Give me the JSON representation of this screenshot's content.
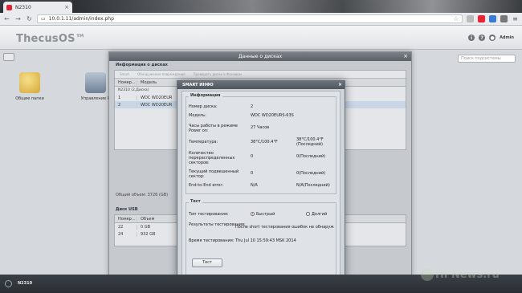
{
  "browser": {
    "tab_title": "N2310",
    "url": "10.0.1.11/admin/index.php"
  },
  "app": {
    "logo": "ThecusOS™",
    "admin_label": "Admin"
  },
  "desktop": {
    "search_placeholder": "Поиск подсистемы",
    "icons": [
      {
        "label": "Общие папки"
      },
      {
        "label": "Управление R"
      }
    ]
  },
  "disk_window": {
    "title": "Данные о дисках",
    "section_title": "Информация о дисках",
    "toolbar": [
      "Smart",
      "Обнаружение повреждения",
      "Проверить диски в Фоновом"
    ],
    "columns": [
      "Номер...",
      "Модель"
    ],
    "group_label": "N2310 (2,Диска)",
    "rows": [
      {
        "num": "1",
        "model": "WDC WD20EUR"
      },
      {
        "num": "2",
        "model": "WDC WD20EUR"
      }
    ],
    "total": "Общий объем: 3726 (GB)",
    "usb_title": "Диск USB",
    "usb_columns": [
      "Номер...",
      "Объем"
    ],
    "usb_rows": [
      {
        "num": "22",
        "size": "0 GB"
      },
      {
        "num": "24",
        "size": "932 GB"
      }
    ]
  },
  "smart": {
    "title": "SMART ИНФО",
    "info_legend": "Информация",
    "rows": [
      {
        "key": "Номер диска:",
        "v1": "2",
        "v2": ""
      },
      {
        "key": "Модель:",
        "v1": "WDC WD20EURS-63S",
        "v2": ""
      },
      {
        "key": "Часы работы в режиме Power on:",
        "v1": "27 Часов",
        "v2": ""
      },
      {
        "key": "Температура:",
        "v1": "38°C/100.4°F",
        "v2": "38°C/100.4°F (Последний)"
      },
      {
        "key": "Количество перераспределенных секторов:",
        "v1": "0",
        "v2": "0(Последний)"
      },
      {
        "key": "Текущий подвешенный сектор:",
        "v1": "0",
        "v2": "0(Последний)"
      },
      {
        "key": "End-to-End error:",
        "v1": "N/A",
        "v2": "N/A(Последний)"
      }
    ],
    "test_legend": "Тест",
    "test_type_label": "Тип тестирования:",
    "test_fast": "Быстрый",
    "test_long": "Долгий",
    "results_label": "Результаты тестирования:",
    "results_value": "После short тестирования ошибок не обнаруж",
    "time_label": "Время тестирования:",
    "time_value": "Thu Jul 10 15:59:43 MSK 2014",
    "test_button": "Тест"
  },
  "taskbar": {
    "label": "N2310"
  },
  "watermark": "Hi News.ru"
}
